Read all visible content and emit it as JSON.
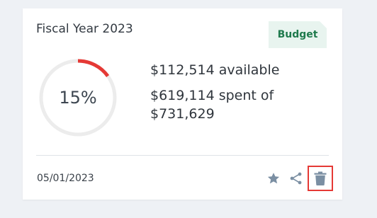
{
  "card": {
    "title": "Fiscal Year 2023",
    "badge": "Budget",
    "progress": {
      "percent_label": "15%",
      "fraction": 0.15,
      "color": "#e53935",
      "track_color": "#ececec"
    },
    "available": "$112,514 available",
    "spent": "$619,114 spent of $731,629",
    "date": "05/01/2023",
    "actions": {
      "star_icon": "star-icon",
      "share_icon": "share-icon",
      "delete_icon": "trash-icon",
      "highlight_color": "#e53935"
    }
  }
}
